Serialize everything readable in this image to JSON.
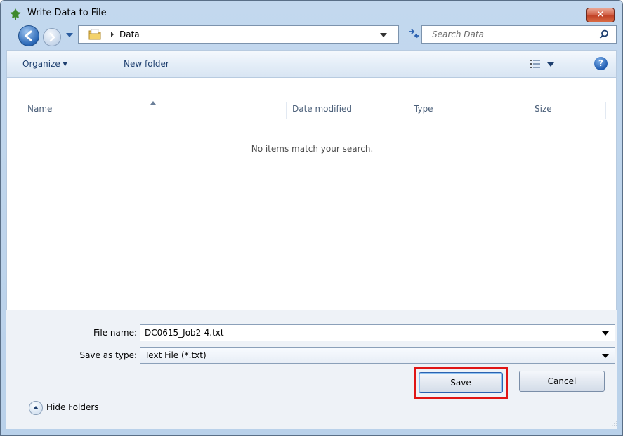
{
  "window": {
    "title": "Write Data to File",
    "close_label": "✕"
  },
  "address": {
    "current_folder": "Data",
    "search_placeholder": "Search Data"
  },
  "toolbar": {
    "organize_label": "Organize ▾",
    "new_folder_label": "New folder",
    "help_label": "?"
  },
  "columns": [
    "Name",
    "Date modified",
    "Type",
    "Size"
  ],
  "list": {
    "empty_message": "No items match your search."
  },
  "form": {
    "file_name_label": "File name:",
    "file_name_value": "DC0615_Job2-4.txt",
    "save_type_label": "Save as type:",
    "save_type_value": "Text File (*.txt)"
  },
  "footer": {
    "hide_folders_label": "Hide Folders",
    "save_label": "Save",
    "cancel_label": "Cancel"
  },
  "colors": {
    "highlight": "#e01515",
    "accent": "#2b62b0"
  }
}
